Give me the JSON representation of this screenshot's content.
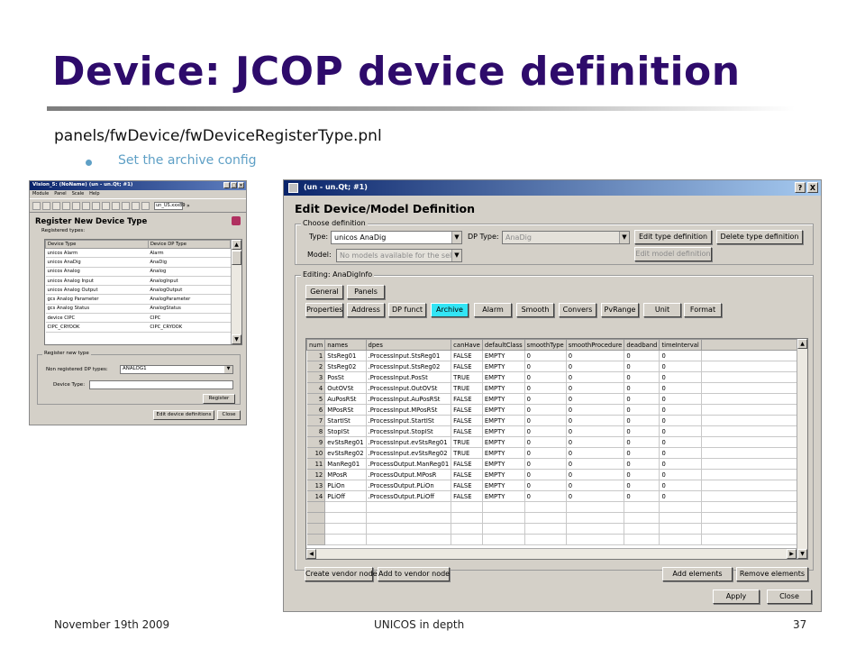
{
  "slide": {
    "title": "Device: JCOP device definition",
    "path": "panels/fwDevice/fwDeviceRegisterType.pnl",
    "bullet": "Set the archive config",
    "footer_date": "November 19th 2009",
    "footer_center": "UNICOS in depth",
    "footer_page": "37"
  },
  "small_window": {
    "title": "Vision_5: (NoName) (un - un.Qt; #1)",
    "menu": [
      "Module",
      "Panel",
      "Scale",
      "Help"
    ],
    "toolbar_combo": "un_US.xxx89",
    "toolbar_more": "»",
    "heading": "Register New Device Type",
    "registered_label": "Registered types:",
    "columns": [
      "Device Type",
      "Device DP Type"
    ],
    "rows": [
      [
        "unicos Alarm",
        "Alarm"
      ],
      [
        "unicos AnaDig",
        "AnaDig"
      ],
      [
        "unicos Analog",
        "Analog"
      ],
      [
        "unicos Analog Input",
        "AnalogInput"
      ],
      [
        "unicos Analog Output",
        "AnalogOutput"
      ],
      [
        "gcs Analog Parameter",
        "AnalogParameter"
      ],
      [
        "gcs Analog Status",
        "AnalogStatus"
      ],
      [
        "device CIPC",
        "CIPC"
      ],
      [
        "CIPC_CRYOOK",
        "CIPC_CRYOOK"
      ]
    ],
    "group_title": "Register new type",
    "non_registered_label": "Non registered DP types:",
    "non_registered_value": "ANALOG1",
    "device_type_label": "Device Type:",
    "register_button": "Register",
    "edit_defs_button": "Edit device definitions",
    "close_button": "Close"
  },
  "large_window": {
    "title": "(un - un.Qt; #1)",
    "title_buttons": [
      "?",
      "X"
    ],
    "heading": "Edit Device/Model Definition",
    "choose_group": "Choose definition",
    "type_label": "Type:",
    "type_value": "unicos AnaDig",
    "dp_type_label": "DP Type:",
    "dp_type_value": "AnaDig",
    "model_label": "Model:",
    "model_value": "No models available for the select",
    "edit_type_button": "Edit type definition",
    "delete_type_button": "Delete type definition",
    "edit_model_button": "Edit model definition",
    "editing_group": "Editing: AnaDigInfo",
    "tabs_row1": [
      "General",
      "Panels"
    ],
    "tabs_row2": [
      "Properties",
      "Address",
      "DP funct",
      "Archive",
      "Alarm",
      "Smooth",
      "Convers",
      "PvRange",
      "Unit",
      "Format"
    ],
    "active_tab": "Archive",
    "columns": [
      "num",
      "names",
      "dpes",
      "canHave",
      "defaultClass",
      "smoothType",
      "smoothProcedure",
      "deadband",
      "timeInterval"
    ],
    "rows": [
      [
        "1",
        "StsReg01",
        ".ProcessInput.StsReg01",
        "FALSE",
        "EMPTY",
        "0",
        "0",
        "0",
        "0"
      ],
      [
        "2",
        "StsReg02",
        ".ProcessInput.StsReg02",
        "FALSE",
        "EMPTY",
        "0",
        "0",
        "0",
        "0"
      ],
      [
        "3",
        "PosSt",
        ".ProcessInput.PosSt",
        "TRUE",
        "EMPTY",
        "0",
        "0",
        "0",
        "0"
      ],
      [
        "4",
        "OutOVSt",
        ".ProcessInput.OutOVSt",
        "TRUE",
        "EMPTY",
        "0",
        "0",
        "0",
        "0"
      ],
      [
        "5",
        "AuPosRSt",
        ".ProcessInput.AuPosRSt",
        "FALSE",
        "EMPTY",
        "0",
        "0",
        "0",
        "0"
      ],
      [
        "6",
        "MPosRSt",
        ".ProcessInput.MPosRSt",
        "FALSE",
        "EMPTY",
        "0",
        "0",
        "0",
        "0"
      ],
      [
        "7",
        "StartISt",
        ".ProcessInput.StartISt",
        "FALSE",
        "EMPTY",
        "0",
        "0",
        "0",
        "0"
      ],
      [
        "8",
        "StopISt",
        ".ProcessInput.StopISt",
        "FALSE",
        "EMPTY",
        "0",
        "0",
        "0",
        "0"
      ],
      [
        "9",
        "evStsReg01",
        ".ProcessInput.evStsReg01",
        "TRUE",
        "EMPTY",
        "0",
        "0",
        "0",
        "0"
      ],
      [
        "10",
        "evStsReg02",
        ".ProcessInput.evStsReg02",
        "TRUE",
        "EMPTY",
        "0",
        "0",
        "0",
        "0"
      ],
      [
        "11",
        "ManReg01",
        ".ProcessOutput.ManReg01",
        "FALSE",
        "EMPTY",
        "0",
        "0",
        "0",
        "0"
      ],
      [
        "12",
        "MPosR",
        ".ProcessOutput.MPosR",
        "FALSE",
        "EMPTY",
        "0",
        "0",
        "0",
        "0"
      ],
      [
        "13",
        "PLiOn",
        ".ProcessOutput.PLiOn",
        "FALSE",
        "EMPTY",
        "0",
        "0",
        "0",
        "0"
      ],
      [
        "14",
        "PLiOff",
        ".ProcessOutput.PLiOff",
        "FALSE",
        "EMPTY",
        "0",
        "0",
        "0",
        "0"
      ]
    ],
    "create_vendor_button": "Create vendor node",
    "add_vendor_button": "Add to vendor node",
    "add_elements_button": "Add elements",
    "remove_elements_button": "Remove elements",
    "apply_button": "Apply",
    "close_button": "Close",
    "active_tab_color": "#33e5f5"
  }
}
